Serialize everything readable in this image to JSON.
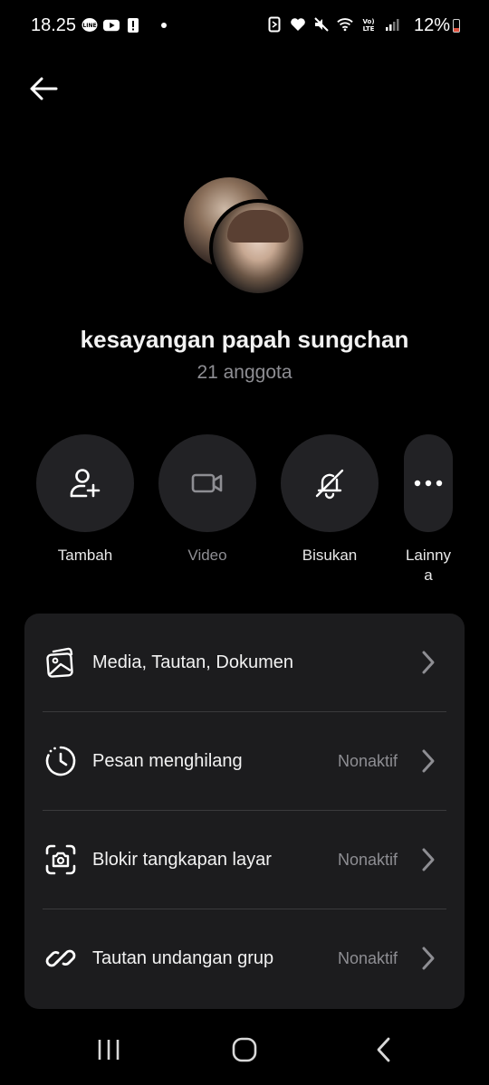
{
  "status_bar": {
    "time": "18.25",
    "battery": "12%",
    "left_icons": [
      "line-icon",
      "youtube-icon",
      "alert-icon",
      "dot-icon"
    ],
    "right_icons": [
      "nfc-icon",
      "heart-icon",
      "mute-icon",
      "wifi-icon",
      "volte-icon",
      "signal-icon"
    ],
    "battery_color": "#e0523f"
  },
  "header": {
    "back_icon": "arrow-left-icon"
  },
  "group": {
    "name": "kesayangan papah sungchan",
    "member_count": "21 anggota"
  },
  "actions": [
    {
      "label": "Tambah",
      "icon": "add-user-icon",
      "enabled": true
    },
    {
      "label": "Video",
      "icon": "video-camera-icon",
      "enabled": false
    },
    {
      "label": "Bisukan",
      "icon": "bell-off-icon",
      "enabled": true
    },
    {
      "label": "Lainnya",
      "icon": "more-icon",
      "enabled": true
    }
  ],
  "settings": [
    {
      "label": "Media, Tautan, Dokumen",
      "value": "",
      "icon": "media-gallery-icon"
    },
    {
      "label": "Pesan menghilang",
      "value": "Nonaktif",
      "icon": "timer-icon"
    },
    {
      "label": "Blokir tangkapan layar",
      "value": "Nonaktif",
      "icon": "screenshot-block-icon"
    },
    {
      "label": "Tautan undangan grup",
      "value": "Nonaktif",
      "icon": "link-icon"
    }
  ],
  "nav": {
    "icons": [
      "recents-icon",
      "home-icon",
      "back-icon"
    ]
  },
  "colors": {
    "background": "#000000",
    "card": "#1c1c1e",
    "action_circle": "#222225",
    "muted_text": "#8e8e93"
  }
}
